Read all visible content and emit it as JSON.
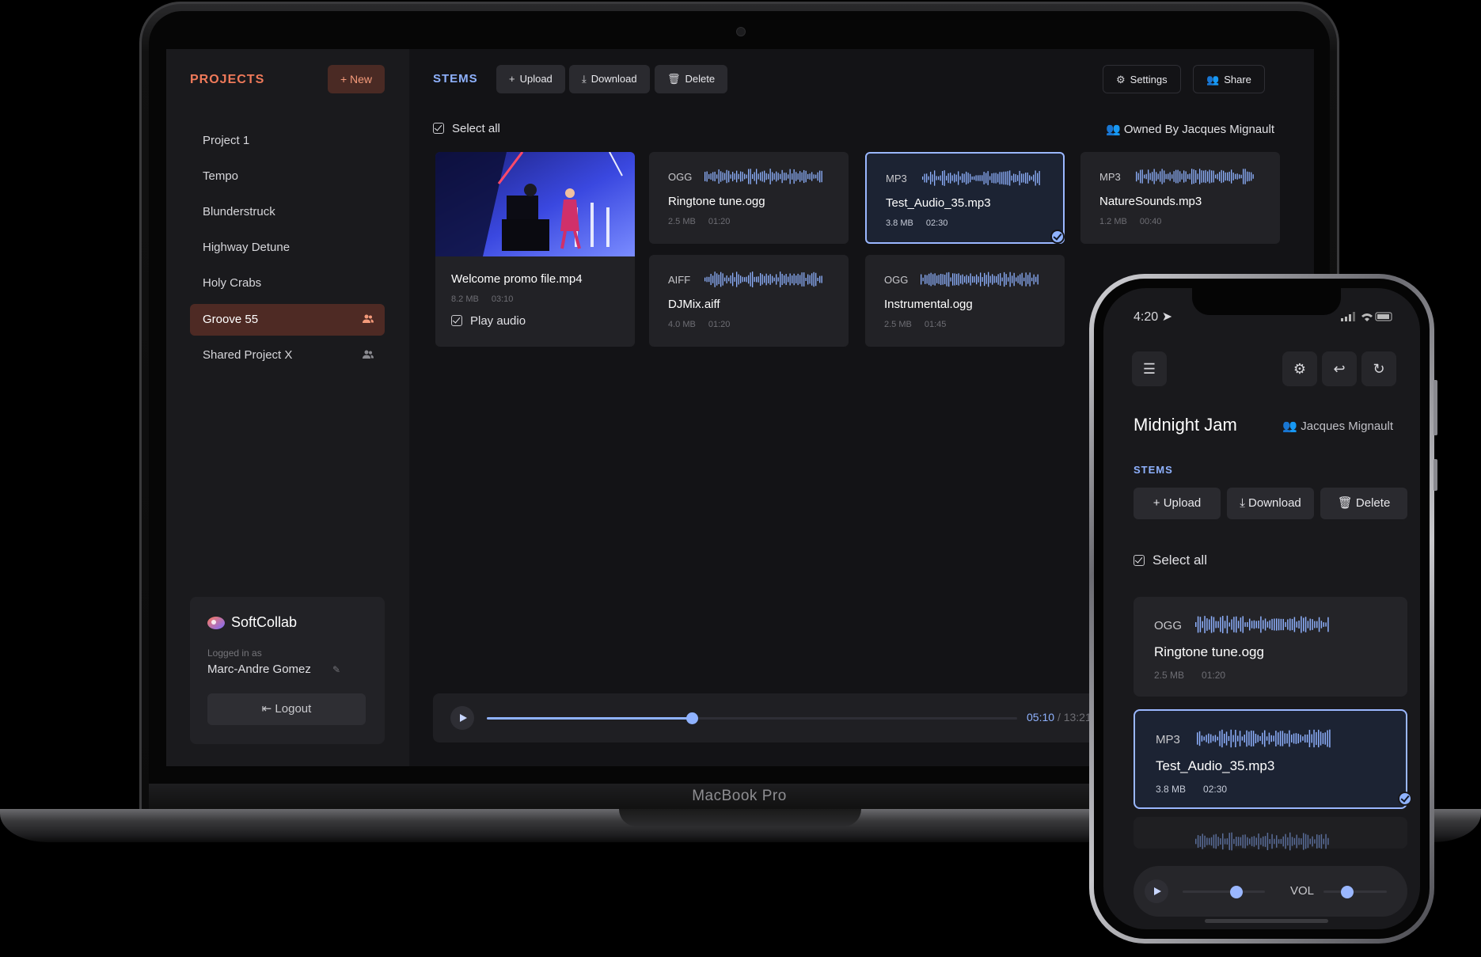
{
  "device_label": "MacBook Pro",
  "sidebar": {
    "title": "PROJECTS",
    "new_label": "+ New",
    "projects": [
      {
        "label": "Project 1",
        "shared": false,
        "active": false
      },
      {
        "label": "Tempo",
        "shared": false,
        "active": false
      },
      {
        "label": "Blunderstruck",
        "shared": false,
        "active": false
      },
      {
        "label": "Highway Detune",
        "shared": false,
        "active": false
      },
      {
        "label": "Holy Crabs",
        "shared": false,
        "active": false
      },
      {
        "label": "Groove 55",
        "shared": true,
        "active": true
      },
      {
        "label": "Shared Project X",
        "shared": true,
        "active": false
      }
    ],
    "brand": "SoftCollab",
    "logged_in_label": "Logged in as",
    "user": "Marc-Andre Gomez",
    "logout_label": "Logout"
  },
  "toolbar": {
    "section_label": "STEMS",
    "upload_label": "Upload",
    "download_label": "Download",
    "delete_label": "Delete",
    "settings_label": "Settings",
    "share_label": "Share"
  },
  "select_all_label": "Select all",
  "owner_label": "Owned By Jacques Mignault",
  "video_file": {
    "name": "Welcome promo file.mp4",
    "size": "8.2 MB",
    "duration": "03:10",
    "play_audio_label": "Play audio"
  },
  "files": [
    {
      "type": "OGG",
      "name": "Ringtone tune.ogg",
      "size": "2.5 MB",
      "duration": "01:20",
      "selected": false
    },
    {
      "type": "MP3",
      "name": "Test_Audio_35.mp3",
      "size": "3.8 MB",
      "duration": "02:30",
      "selected": true
    },
    {
      "type": "MP3",
      "name": "NatureSounds.mp3",
      "size": "1.2 MB",
      "duration": "00:40",
      "selected": false
    },
    {
      "type": "AIFF",
      "name": "DJMix.aiff",
      "size": "4.0 MB",
      "duration": "01:20",
      "selected": false
    },
    {
      "type": "OGG",
      "name": "Instrumental.ogg",
      "size": "2.5 MB",
      "duration": "01:45",
      "selected": false
    }
  ],
  "player": {
    "current": "05:10",
    "total": "/ 13:21",
    "progress": 0.387
  },
  "phone": {
    "time": "4:20",
    "title": "Midnight Jam",
    "owner": "Jacques Mignault",
    "stems_label": "STEMS",
    "upload_label": "Upload",
    "download_label": "Download",
    "delete_label": "Delete",
    "select_all_label": "Select all",
    "files": [
      {
        "type": "OGG",
        "name": "Ringtone tune.ogg",
        "size": "2.5 MB",
        "duration": "01:20",
        "selected": false
      },
      {
        "type": "MP3",
        "name": "Test_Audio_35.mp3",
        "size": "3.8 MB",
        "duration": "02:30",
        "selected": true
      }
    ],
    "vol_label": "VOL",
    "seek_progress": 0.65,
    "volume": 0.38
  },
  "colors": {
    "accent_blue": "#8fb2ff",
    "accent_orange": "#f07a5a",
    "active_project_bg": "#4e2a24"
  },
  "icons": {
    "menu": "hamburger-icon",
    "settings": "gear-icon",
    "reply": "reply-icon",
    "history": "history-icon"
  }
}
